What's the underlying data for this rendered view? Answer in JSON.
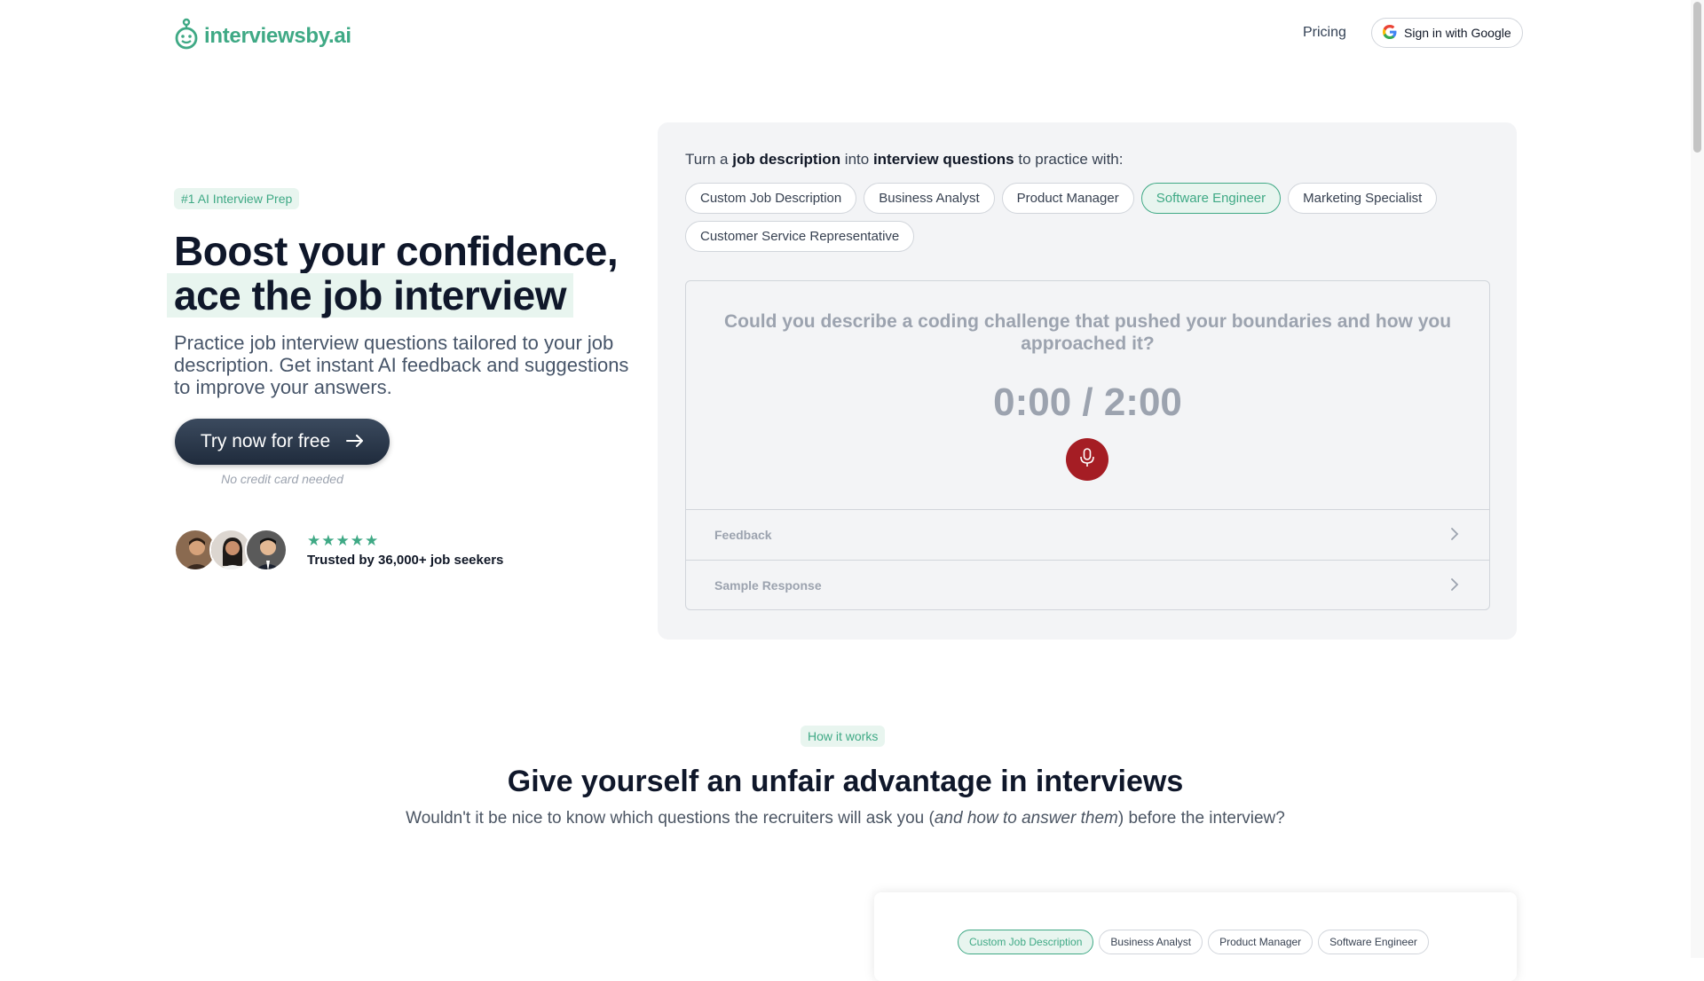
{
  "brand": {
    "name": "interviewsby.ai",
    "accent": "#3fa985",
    "dark": "#1f2b3c"
  },
  "nav": {
    "pricing": "Pricing",
    "signin": "Sign in with Google"
  },
  "hero": {
    "badge": "#1 AI Interview Prep",
    "title_line1": "Boost your confidence,",
    "title_line2": "ace the job interview",
    "subtitle": "Practice job interview questions tailored to your job description. Get instant AI feedback and suggestions to improve your answers.",
    "cta": "Try now for free",
    "no_credit": "No credit card needed",
    "stars": "★★★★★",
    "trusted": "Trusted by 36,000+ job seekers"
  },
  "practice": {
    "intro_pre": "Turn a ",
    "intro_b1": "job description",
    "intro_mid": " into ",
    "intro_b2": "interview questions",
    "intro_post": " to practice with:",
    "chips": [
      "Custom Job Description",
      "Business Analyst",
      "Product Manager",
      "Software Engineer",
      "Marketing Specialist",
      "Customer Service Representative"
    ],
    "active_chip": "Software Engineer",
    "question": "Could you describe a coding challenge that pushed your boundaries and how you approached it?",
    "timer": "0:00 / 2:00",
    "mic_color": "#a51d24",
    "feedback": "Feedback",
    "sample": "Sample Response"
  },
  "how": {
    "badge": "How it works",
    "title": "Give yourself an unfair advantage in interviews",
    "sub_pre": "Wouldn't it be nice to know which questions the recruiters will ask you (",
    "sub_em": "and how to answer them",
    "sub_post": ") before the interview?",
    "preview_chips": [
      "Custom Job Description",
      "Business Analyst",
      "Product Manager",
      "Software Engineer"
    ],
    "preview_active": "Custom Job Description"
  }
}
